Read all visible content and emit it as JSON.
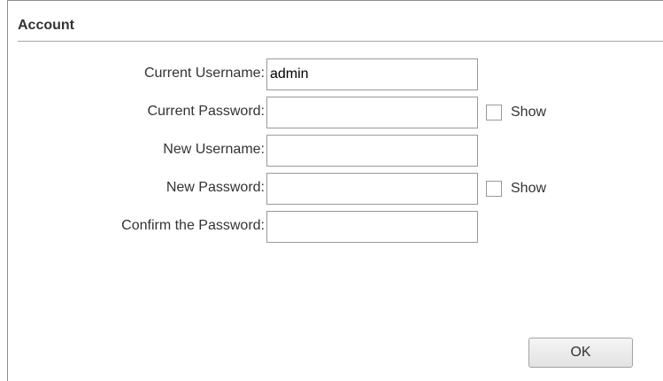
{
  "panel": {
    "title": "Account"
  },
  "form": {
    "current_username": {
      "label": "Current Username:",
      "value": "admin"
    },
    "current_password": {
      "label": "Current Password:",
      "value": "",
      "show_label": "Show",
      "show_checked": false
    },
    "new_username": {
      "label": "New Username:",
      "value": ""
    },
    "new_password": {
      "label": "New Password:",
      "value": "",
      "show_label": "Show",
      "show_checked": false
    },
    "confirm_password": {
      "label": "Confirm the Password:",
      "value": ""
    }
  },
  "actions": {
    "ok_label": "OK"
  }
}
